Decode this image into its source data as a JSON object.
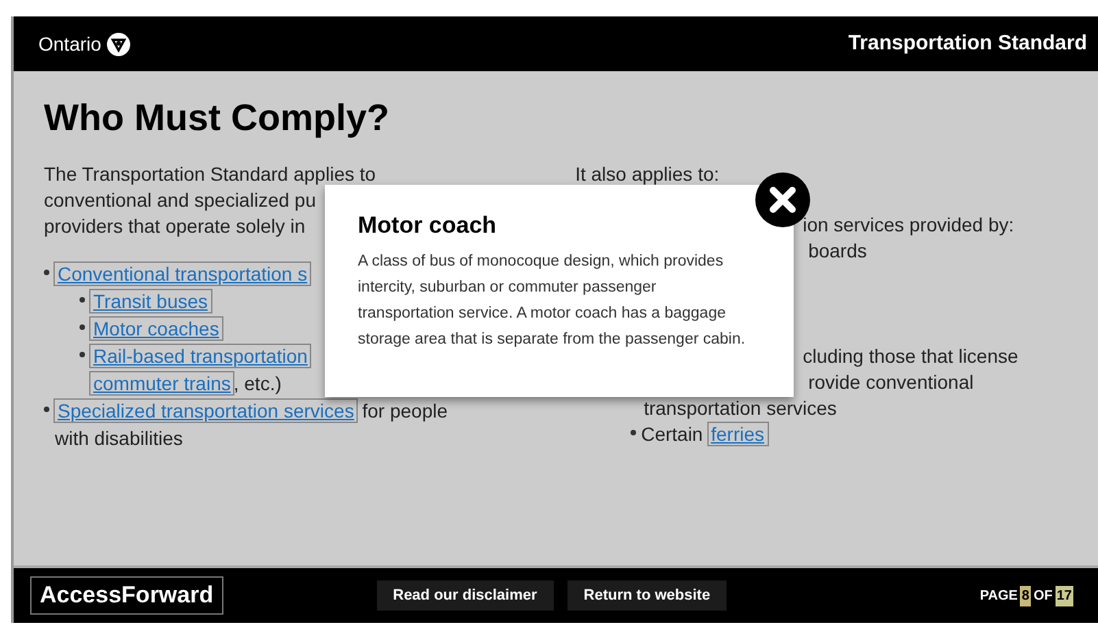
{
  "header": {
    "brand": "Ontario",
    "title": "Transportation Standard"
  },
  "heading": "Who Must Comply?",
  "left_column": {
    "intro_lines": [
      "The Transportation Standard applies to",
      "conventional and specialized pu",
      "providers that operate solely in"
    ],
    "items": [
      {
        "lines": [
          [
            {
              "kind": "link",
              "text": "Conventional transportation s"
            }
          ]
        ],
        "children": [
          {
            "lines": [
              [
                {
                  "kind": "link",
                  "text": "Transit buses"
                }
              ]
            ]
          },
          {
            "lines": [
              [
                {
                  "kind": "link",
                  "text": "Motor coaches"
                }
              ]
            ]
          },
          {
            "lines": [
              [
                {
                  "kind": "link",
                  "text": "Rail-based transportation"
                }
              ],
              [
                {
                  "kind": "link",
                  "text": "commuter trains"
                },
                {
                  "kind": "text",
                  "text": ", etc.)"
                }
              ]
            ]
          }
        ]
      },
      {
        "lines": [
          [
            {
              "kind": "link",
              "text": "Specialized transportation services"
            },
            {
              "kind": "text",
              "text": " for people"
            }
          ],
          [
            {
              "kind": "text",
              "text": "with disabilities"
            }
          ]
        ]
      }
    ]
  },
  "right_column": {
    "intro": "It also applies to:",
    "fragments": [
      "ion services provided by:",
      "boards",
      "cluding those that license",
      "rovide conventional",
      "transportation services"
    ],
    "items": [
      {
        "lines": [
          [
            {
              "kind": "text",
              "text": "Certain "
            },
            {
              "kind": "link",
              "text": "ferries"
            }
          ]
        ]
      }
    ]
  },
  "popup": {
    "title": "Motor coach",
    "body": "A class of bus of monocoque design, which provides intercity, suburban or commuter passenger transportation service. A motor coach has a baggage storage area that is separate from the passenger cabin."
  },
  "footer": {
    "logo": "AccessForward",
    "buttons": [
      "Read our disclaimer",
      "Return to website"
    ],
    "page_label": "PAGE",
    "page_current": "8",
    "page_of": "OF",
    "page_total": "17"
  }
}
